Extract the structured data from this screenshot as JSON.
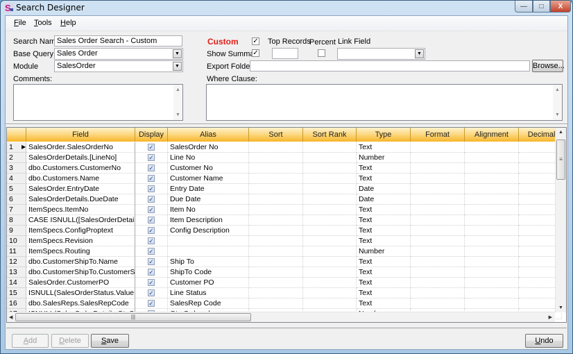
{
  "window": {
    "title": "Search Designer",
    "controls": {
      "minimize": "—",
      "maximize": "□",
      "close": "X"
    }
  },
  "menu": [
    {
      "label": "File",
      "accel": "F",
      "rest": "ile"
    },
    {
      "label": "Tools",
      "accel": "T",
      "rest": "ools"
    },
    {
      "label": "Help",
      "accel": "H",
      "rest": "elp"
    }
  ],
  "form": {
    "search_name_label": "Search Name",
    "search_name_value": "Sales Order Search - Custom",
    "base_query_label": "Base Query",
    "base_query_value": "Sales Order",
    "module_label": "Module",
    "module_value": "SalesOrder",
    "comments_label": "Comments:",
    "comments_value": "",
    "custom_label": "Custom",
    "custom_checked": true,
    "top_records_label": "Top Records",
    "top_records_value": "",
    "percent_label": "Percent",
    "percent_checked": false,
    "link_field_label": "Link Field",
    "link_field_value": "",
    "show_summary_label": "Show Summar",
    "show_summary_checked": true,
    "export_folder_label": "Export Folder",
    "export_folder_value": "",
    "browse_label": "Browse...",
    "where_clause_label": "Where Clause:",
    "where_clause_value": ""
  },
  "grid": {
    "columns": [
      "Field",
      "Display",
      "Alias",
      "Sort",
      "Sort Rank",
      "Type",
      "Format",
      "Alignment",
      "Decimals"
    ],
    "current_row": 1,
    "rows": [
      {
        "n": "1",
        "field": "SalesOrder.SalesOrderNo",
        "display": true,
        "alias": "SalesOrder No",
        "sort": "",
        "sort_rank": "",
        "type": "Text",
        "format": "",
        "alignment": "",
        "decimals": ""
      },
      {
        "n": "2",
        "field": "SalesOrderDetails.[LineNo]",
        "display": true,
        "alias": "Line No",
        "sort": "",
        "sort_rank": "",
        "type": "Number",
        "format": "",
        "alignment": "",
        "decimals": ""
      },
      {
        "n": "3",
        "field": "dbo.Customers.CustomerNo",
        "display": true,
        "alias": "Customer No",
        "sort": "",
        "sort_rank": "",
        "type": "Text",
        "format": "",
        "alignment": "",
        "decimals": ""
      },
      {
        "n": "4",
        "field": "dbo.Customers.Name",
        "display": true,
        "alias": "Customer Name",
        "sort": "",
        "sort_rank": "",
        "type": "Text",
        "format": "",
        "alignment": "",
        "decimals": ""
      },
      {
        "n": "5",
        "field": "SalesOrder.EntryDate",
        "display": true,
        "alias": "Entry Date",
        "sort": "",
        "sort_rank": "",
        "type": "Date",
        "format": "",
        "alignment": "",
        "decimals": ""
      },
      {
        "n": "6",
        "field": "SalesOrderDetails.DueDate",
        "display": true,
        "alias": "Due Date",
        "sort": "",
        "sort_rank": "",
        "type": "Date",
        "format": "",
        "alignment": "",
        "decimals": ""
      },
      {
        "n": "7",
        "field": "ItemSpecs.ItemNo",
        "display": true,
        "alias": "Item No",
        "sort": "",
        "sort_rank": "",
        "type": "Text",
        "format": "",
        "alignment": "",
        "decimals": ""
      },
      {
        "n": "8",
        "field": "CASE  ISNULL([SalesOrderDetails].[...",
        "display": true,
        "alias": "Item Description",
        "sort": "",
        "sort_rank": "",
        "type": "Text",
        "format": "",
        "alignment": "",
        "decimals": ""
      },
      {
        "n": "9",
        "field": "ItemSpecs.ConfigProptext",
        "display": true,
        "alias": "Config Description",
        "sort": "",
        "sort_rank": "",
        "type": "Text",
        "format": "",
        "alignment": "",
        "decimals": ""
      },
      {
        "n": "10",
        "field": "ItemSpecs.Revision",
        "display": true,
        "alias": "",
        "sort": "",
        "sort_rank": "",
        "type": "Text",
        "format": "",
        "alignment": "",
        "decimals": ""
      },
      {
        "n": "11",
        "field": "ItemSpecs.Routing",
        "display": true,
        "alias": "",
        "sort": "",
        "sort_rank": "",
        "type": "Number",
        "format": "",
        "alignment": "",
        "decimals": ""
      },
      {
        "n": "12",
        "field": "dbo.CustomerShipTo.Name",
        "display": true,
        "alias": "Ship To",
        "sort": "",
        "sort_rank": "",
        "type": "Text",
        "format": "",
        "alignment": "",
        "decimals": ""
      },
      {
        "n": "13",
        "field": "dbo.CustomerShipTo.CustomerShip...",
        "display": true,
        "alias": "ShipTo Code",
        "sort": "",
        "sort_rank": "",
        "type": "Text",
        "format": "",
        "alignment": "",
        "decimals": ""
      },
      {
        "n": "14",
        "field": "SalesOrder.CustomerPO",
        "display": true,
        "alias": "Customer PO",
        "sort": "",
        "sort_rank": "",
        "type": "Text",
        "format": "",
        "alignment": "",
        "decimals": ""
      },
      {
        "n": "15",
        "field": "ISNULL(SalesOrderStatus.Value,  'E...",
        "display": true,
        "alias": "Line Status",
        "sort": "",
        "sort_rank": "",
        "type": "Text",
        "format": "",
        "alignment": "",
        "decimals": ""
      },
      {
        "n": "16",
        "field": "dbo.SalesReps.SalesRepCode",
        "display": true,
        "alias": "SalesRep Code",
        "sort": "",
        "sort_rank": "",
        "type": "Text",
        "format": "",
        "alignment": "",
        "decimals": ""
      },
      {
        "n": "17",
        "field": "ISNULL(SalesOrderDetails.QtyOrder...",
        "display": true,
        "alias": "Qty Ordered",
        "sort": "",
        "sort_rank": "",
        "type": "Number",
        "format": "",
        "alignment": "",
        "decimals": ""
      }
    ]
  },
  "footer": {
    "add_label": "Add",
    "add_accel": "A",
    "delete_label": "Delete",
    "delete_accel": "D",
    "save_label": "Save",
    "save_accel": "S",
    "undo_label": "Undo",
    "undo_accel": "U"
  },
  "glyphs": {
    "check": "✓",
    "up": "▲",
    "down": "▼",
    "left": "◀",
    "right": "▶",
    "grip_v": "≡",
    "grip_h": "|||",
    "row_pointer": "▶"
  },
  "colors": {
    "custom_label": "#e0201a",
    "header_gradient_top": "#fff2cf",
    "header_gradient_bottom": "#f7b52a"
  }
}
